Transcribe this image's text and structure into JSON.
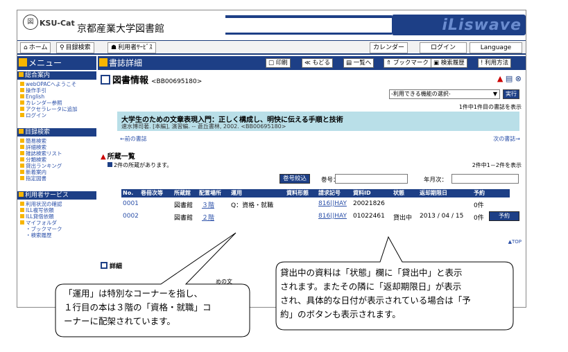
{
  "header": {
    "logo_seal": "図",
    "logo_text": "KSU-Cat",
    "library_name": "京都産業大学図書館",
    "brand": "iLiswave"
  },
  "topnav": {
    "home": "ホーム",
    "catalog_search": "目録検索",
    "user_service": "利用者ｻｰﾋﾞｽ",
    "calendar": "カレンダー",
    "login": "ログイン",
    "language": "Language"
  },
  "sidebar": {
    "menu_title": "メニュー",
    "sections": [
      {
        "title": "総合案内",
        "items": [
          "webOPACへようこそ",
          "操作手引",
          "English",
          "カレンダー参照",
          "アクセラレータに追加",
          "ログイン"
        ]
      },
      {
        "title": "目録検索",
        "items": [
          "簡易検索",
          "詳細検索",
          "雑誌検索リスト",
          "分類検索",
          "貸出ランキング",
          "新着案内",
          "指定図書"
        ]
      },
      {
        "title": "利用者サービス",
        "items": [
          "利用状況の確認",
          "ILL複写依頼",
          "ILL貸借依頼",
          "マイフォルダ",
          "・ブックマーク",
          "・検索履歴"
        ]
      }
    ]
  },
  "main": {
    "title": "書誌詳細",
    "toolbar": [
      "印刷",
      "もどる",
      "一覧へ",
      "ブックマーク",
      "検索履歴",
      "利用方法"
    ],
    "section_title": "図書情報",
    "record_id": "<BB00695180>",
    "function_select": "-利用できる機能の選択-",
    "execute": "実行",
    "count_line": "1件中1件目の書誌を表示",
    "book_title": "大学生のための文章表現入門：正しく構成し、明快に伝える手順と技術",
    "book_sub": "速水博司著. [本編], 演習編. -- 蒼丘書林, 2002. <BB00695180>",
    "prev_link": "←前の書誌",
    "next_link": "次の書誌→",
    "holdings_title": "所蔵一覧",
    "holdings_note": "2件の所蔵があります。",
    "holdings_count": "2件中1－2件を表示",
    "callno_button": "巻号絞込",
    "vol_label": "巻号：",
    "year_label": "年月次：",
    "table_headers": [
      "No.",
      "巻冊次等",
      "所蔵館",
      "配置場所",
      "運用",
      "資料形態",
      "請求記号",
      "資料ID",
      "状態",
      "返却期限日",
      "予約"
    ],
    "rows": [
      {
        "no": "0001",
        "lib": "図書館",
        "loc": "３階",
        "use": "Q：資格・就職",
        "call": "816||HAY",
        "id": "20021826",
        "status": "",
        "due": "",
        "rsv": "0件"
      },
      {
        "no": "0002",
        "lib": "図書館",
        "loc": "２階",
        "use": "",
        "call": "816||HAY",
        "id": "01022461",
        "status": "貸出中",
        "due": "2013 / 04 / 15",
        "rsv": "0件"
      }
    ],
    "reserve_button": "予約",
    "top_link": "▲TOP",
    "detail_title": "詳細",
    "detail_fragment": "めの文"
  },
  "callout_left": {
    "lines": [
      "「運用」は特別なコーナーを指し、",
      "１行目の本は３階の「資格・就職」コ",
      "ーナーに配架されています。"
    ]
  },
  "callout_right": {
    "lines": [
      "貸出中の資料は「状態」欄に「貸出中」と表示",
      "されます。またその隣に「返却期限日」が表示",
      "され、具体的な日付が表示されている場合は「予",
      "約」のボタンも表示されます。"
    ]
  }
}
